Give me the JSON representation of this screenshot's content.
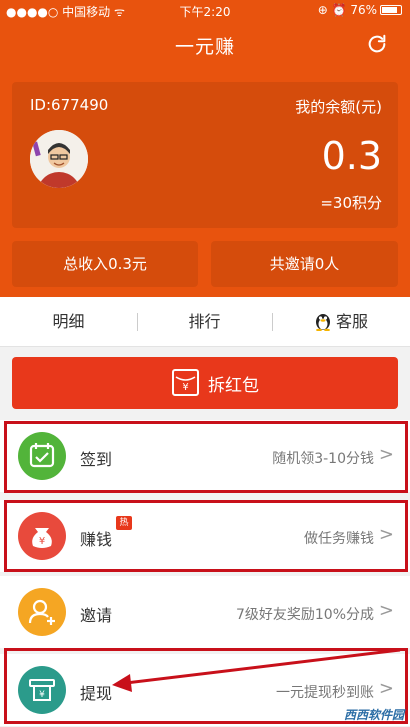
{
  "status_bar": {
    "carrier": "●●●●○ 中国移动 ᯤ",
    "time": "下午2:20",
    "battery": "⊕ ⏰ 76%"
  },
  "app": {
    "title": "一元赚"
  },
  "account": {
    "id": "ID:677490",
    "balance_label": "我的余额(元)",
    "balance": "0.3",
    "points": "=30积分",
    "total_income": "总收入0.3元",
    "invites": "共邀请0人"
  },
  "tabs": [
    {
      "label": "明细"
    },
    {
      "label": "排行"
    },
    {
      "label": "客服"
    }
  ],
  "main_button": {
    "label": "拆红包"
  },
  "rows": [
    {
      "title": "签到",
      "desc": "随机领3-10分钱",
      "color": "#52b43a"
    },
    {
      "title": "赚钱",
      "badge": "热",
      "desc": "做任务赚钱",
      "color": "#e84a3c"
    },
    {
      "title": "邀请",
      "desc": "7级好友奖励10%分成",
      "color": "#f5a623"
    },
    {
      "title": "提现",
      "desc": "一元提现秒到账",
      "color": "#2b9b8b"
    }
  ],
  "watermark": "西西软件园"
}
